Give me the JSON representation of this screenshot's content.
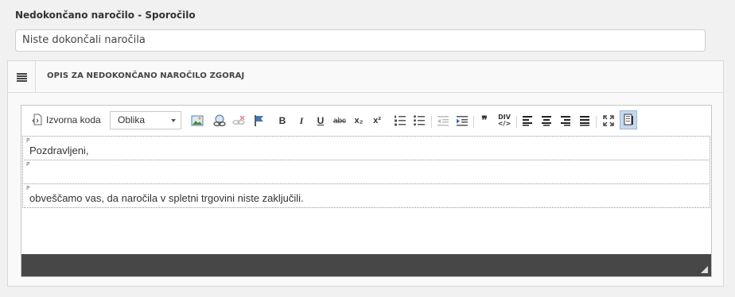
{
  "form": {
    "message_label": "Nedokončano naročilo - Sporočilo",
    "message_value": "Niste dokončali naročila"
  },
  "panel": {
    "title": "OPIS ZA NEDOKONČANO NAROČILO ZGORAJ"
  },
  "toolbar": {
    "source_label": "Izvorna koda",
    "format_value": "Oblika",
    "buttons": [
      {
        "name": "image-icon"
      },
      {
        "name": "link-icon"
      },
      {
        "name": "unlink-icon"
      },
      {
        "name": "anchor-icon"
      },
      {
        "name": "bold-icon",
        "glyph": "B"
      },
      {
        "name": "italic-icon",
        "glyph": "I"
      },
      {
        "name": "underline-icon",
        "glyph": "U"
      },
      {
        "name": "strikethrough-icon",
        "glyph": "abc"
      },
      {
        "name": "subscript-icon",
        "glyph": "x₂"
      },
      {
        "name": "superscript-icon",
        "glyph": "x²"
      },
      {
        "name": "numbered-list-icon"
      },
      {
        "name": "bulleted-list-icon"
      },
      {
        "name": "outdent-icon"
      },
      {
        "name": "indent-icon"
      },
      {
        "name": "blockquote-icon",
        "glyph": "❞"
      },
      {
        "name": "div-container-icon",
        "glyph": "DIV"
      },
      {
        "name": "align-left-icon"
      },
      {
        "name": "align-center-icon"
      },
      {
        "name": "align-right-icon"
      },
      {
        "name": "justify-icon"
      },
      {
        "name": "maximize-icon"
      },
      {
        "name": "show-blocks-icon",
        "active": true
      }
    ]
  },
  "editor": {
    "block_tag": "P",
    "paragraphs": [
      "Pozdravljeni,",
      "",
      "obveščamo vas, da naročila v spletni trgovini niste zaključili."
    ]
  }
}
